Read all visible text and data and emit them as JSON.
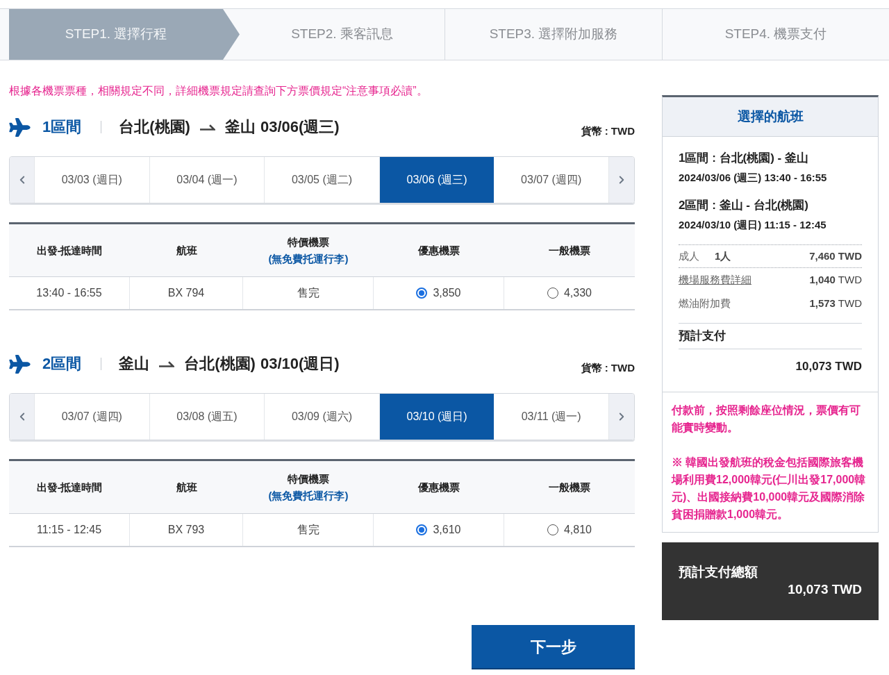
{
  "steps": [
    {
      "label": "STEP1. 選擇行程",
      "selected": true
    },
    {
      "label": "STEP2. 乘客訊息",
      "selected": false
    },
    {
      "label": "STEP3. 選擇附加服務",
      "selected": false
    },
    {
      "label": "STEP4. 機票支付",
      "selected": false
    }
  ],
  "notice": "根據各機票票種，相關規定不同，詳細機票規定請查詢下方票價規定“注意事項必讀”。",
  "segments": [
    {
      "label": "1區間",
      "origin": "台北(桃園)",
      "destination": "釜山",
      "date": "03/06(週三)",
      "currency": "貨幣 : TWD",
      "dates": [
        {
          "label": "03/03 (週日)",
          "selected": false
        },
        {
          "label": "03/04 (週一)",
          "selected": false
        },
        {
          "label": "03/05 (週二)",
          "selected": false
        },
        {
          "label": "03/06 (週三)",
          "selected": true
        },
        {
          "label": "03/07 (週四)",
          "selected": false
        }
      ],
      "table": {
        "columns": [
          {
            "label": "出發-抵達時間"
          },
          {
            "label": "航班"
          },
          {
            "label": "特價機票",
            "note": "(無免費托運行李)"
          },
          {
            "label": "優惠機票"
          },
          {
            "label": "一般機票"
          }
        ],
        "rows": [
          {
            "cells": [
              {
                "kind": "text",
                "text": "13:40 - 16:55"
              },
              {
                "kind": "text",
                "text": "BX 794"
              },
              {
                "kind": "text",
                "text": "售完"
              },
              {
                "kind": "radio",
                "price": "3,850",
                "selected": true
              },
              {
                "kind": "radio",
                "price": "4,330",
                "selected": false
              }
            ]
          }
        ]
      }
    },
    {
      "label": "2區間",
      "origin": "釜山",
      "destination": "台北(桃園)",
      "date": "03/10(週日)",
      "currency": "貨幣 : TWD",
      "dates": [
        {
          "label": "03/07 (週四)",
          "selected": false
        },
        {
          "label": "03/08 (週五)",
          "selected": false
        },
        {
          "label": "03/09 (週六)",
          "selected": false
        },
        {
          "label": "03/10 (週日)",
          "selected": true
        },
        {
          "label": "03/11 (週一)",
          "selected": false
        }
      ],
      "table": {
        "columns": [
          {
            "label": "出發-抵達時間"
          },
          {
            "label": "航班"
          },
          {
            "label": "特價機票",
            "note": "(無免費托運行李)"
          },
          {
            "label": "優惠機票"
          },
          {
            "label": "一般機票"
          }
        ],
        "rows": [
          {
            "cells": [
              {
                "kind": "text",
                "text": "11:15 - 12:45"
              },
              {
                "kind": "text",
                "text": "BX 793"
              },
              {
                "kind": "text",
                "text": "售完"
              },
              {
                "kind": "radio",
                "price": "3,610",
                "selected": true
              },
              {
                "kind": "radio",
                "price": "4,810",
                "selected": false
              }
            ]
          }
        ]
      }
    }
  ],
  "next_button": "下一步",
  "summary": {
    "title": "選擇的航班",
    "segments": [
      {
        "route": "1區間 : 台北(桃園) - 釜山",
        "datetime": "2024/03/06 (週三) 13:40 - 16:55"
      },
      {
        "route": "2區間 : 釜山 - 台北(桃園)",
        "datetime": "2024/03/10 (週日) 11:15 - 12:45"
      }
    ],
    "fees": [
      {
        "kind": "passenger",
        "label": "成人",
        "count": "1人",
        "amount": "7,460 TWD"
      },
      {
        "kind": "link",
        "label": "機場服務費詳細",
        "amount": "**1,040** TWD"
      },
      {
        "kind": "plain",
        "label": "燃油附加費",
        "amount": "**1,573** TWD"
      }
    ],
    "subtotal_label": "預計支付",
    "subtotal": "10,073 TWD",
    "notes": [
      "付款前，按照剩餘座位情況，票價有可能實時變動。",
      "※ 韓國出發航班的稅金包括國際旅客機場利用費12,000韓元(仁川出發17,000韓元)、出國接納費10,000韓元及國際消除貧困捐贈款1,000韓元。"
    ]
  },
  "total": {
    "label": "預計支付總額",
    "amount": "10,073 TWD"
  }
}
